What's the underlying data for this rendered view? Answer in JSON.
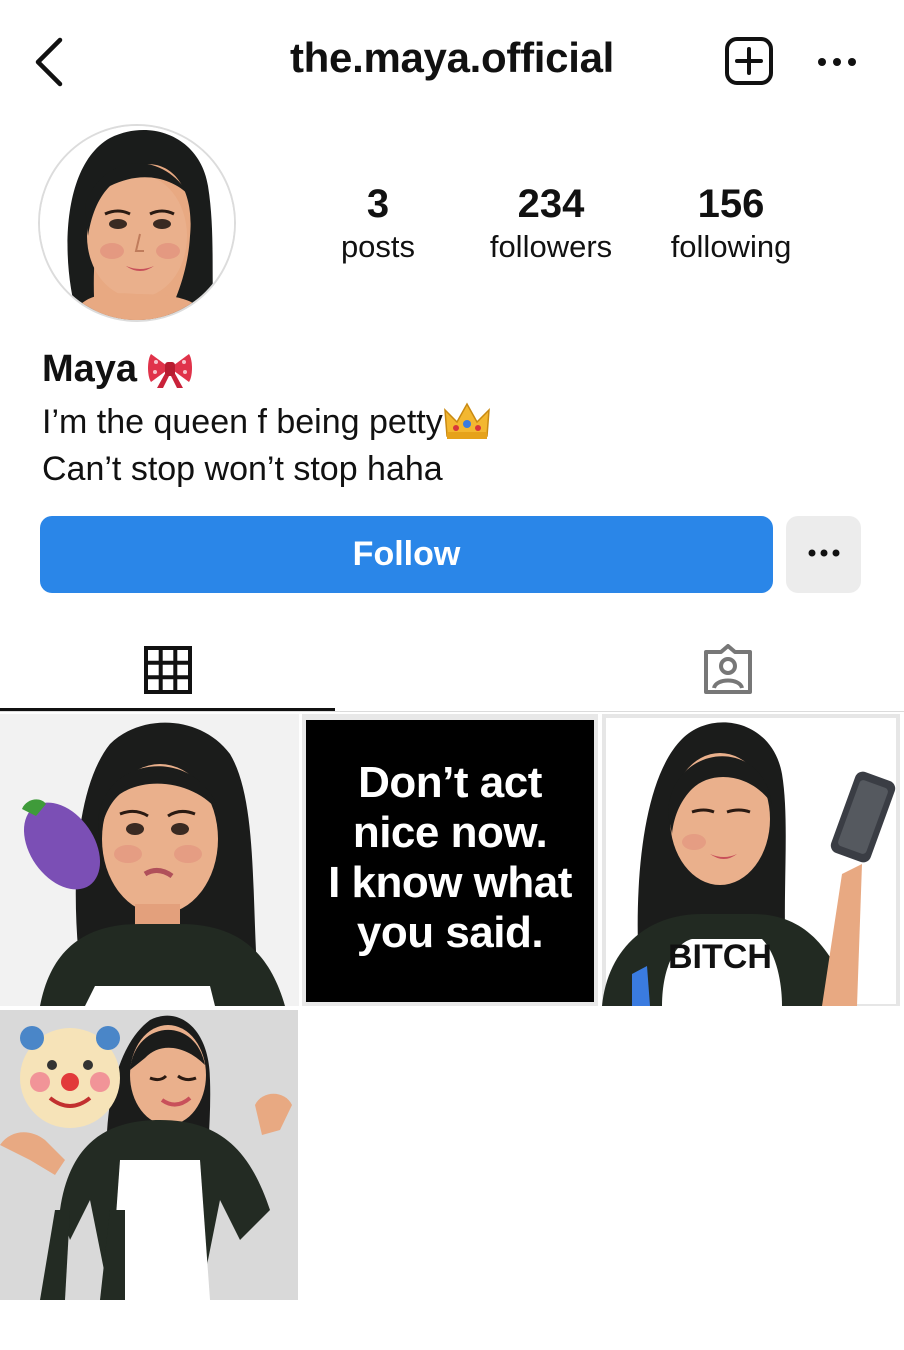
{
  "header": {
    "title": "the.maya.official",
    "icons": {
      "back": "chevron-left-icon",
      "add": "add-post-icon",
      "more": "more-horizontal-icon"
    }
  },
  "profile": {
    "name": "Maya",
    "name_emoji": "bow-emoji",
    "bio_lines": [
      "I’m the queen f being petty",
      "Can’t stop won’t stop haha"
    ],
    "bio_emoji": "crown-emoji"
  },
  "stats": [
    {
      "value": "3",
      "label": "posts"
    },
    {
      "value": "234",
      "label": "followers"
    },
    {
      "value": "156",
      "label": "following"
    }
  ],
  "actions": {
    "follow_label": "Follow",
    "options_icon": "more-horizontal-icon"
  },
  "tabs": [
    {
      "name": "grid",
      "icon": "grid-icon",
      "active": true
    },
    {
      "name": "tagged",
      "icon": "tagged-person-icon",
      "active": false
    }
  ],
  "posts": [
    {
      "kind": "illustration",
      "subject": "woman-with-eggplant"
    },
    {
      "kind": "text",
      "text_lines": [
        "Don’t act",
        "nice now.",
        "I know what",
        "you said."
      ]
    },
    {
      "kind": "illustration",
      "subject": "woman-with-phone",
      "shirt_text": "BITCH"
    },
    {
      "kind": "illustration",
      "subject": "woman-shrugging-with-clown"
    }
  ],
  "colors": {
    "accent": "#2a86e8",
    "text": "#111111",
    "button_secondary": "#ececec"
  }
}
